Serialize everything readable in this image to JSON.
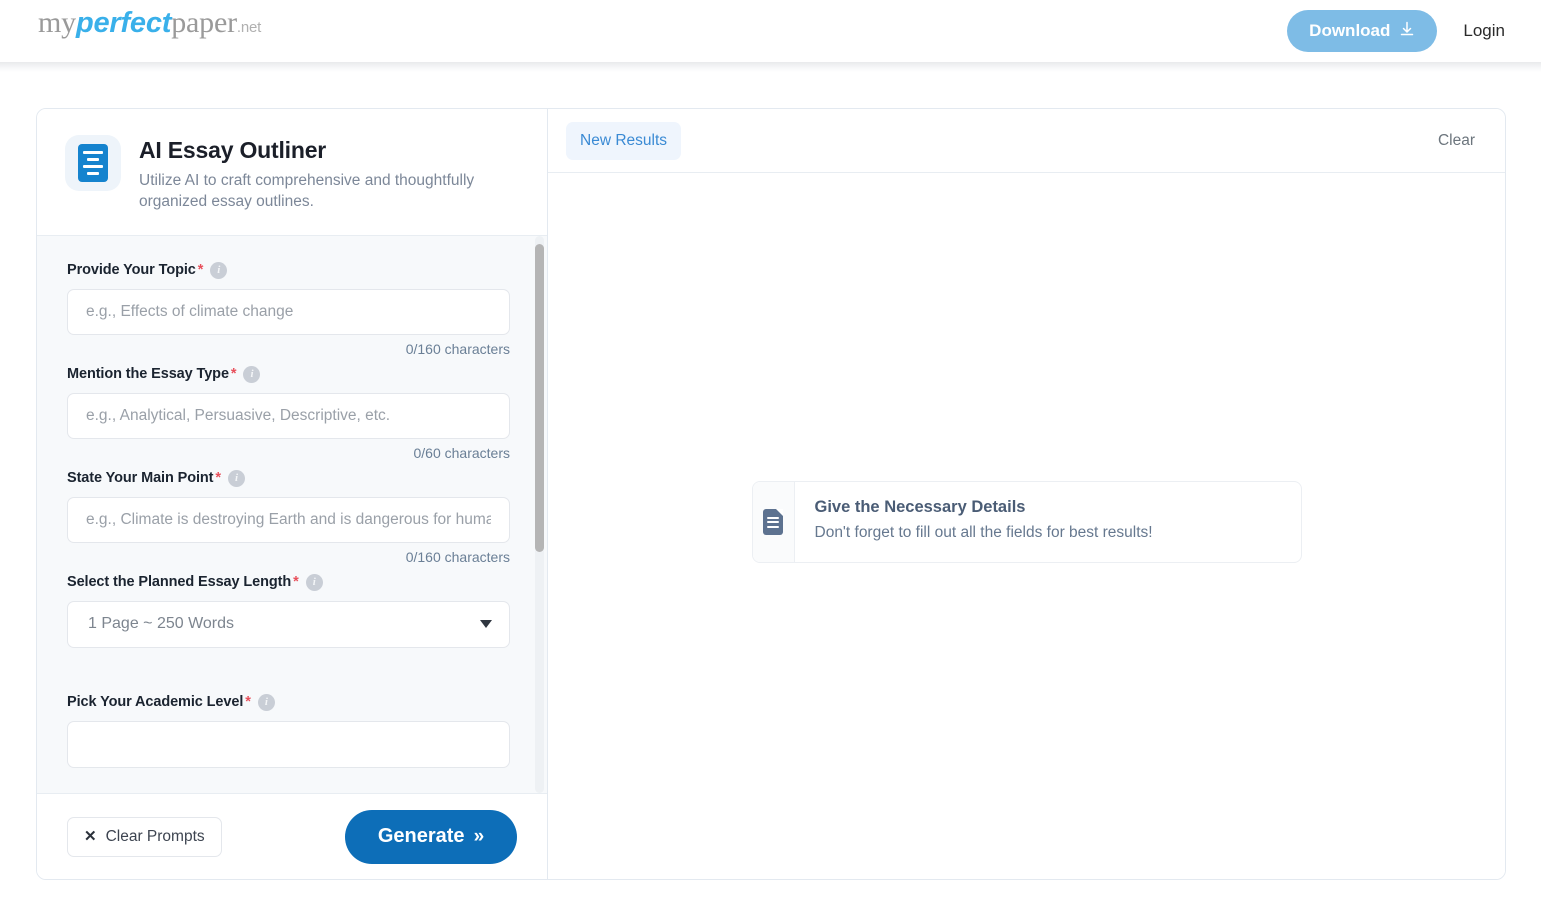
{
  "header": {
    "logo": {
      "part1": "my",
      "part2": "perfect",
      "part3": "paper",
      "part4": ".net"
    },
    "download_label": "Download",
    "download_icon": "download-arrow-icon",
    "login_label": "Login"
  },
  "tool": {
    "icon": "document-lines-icon",
    "title": "AI Essay Outliner",
    "subtitle": "Utilize AI to craft comprehensive and thoughtfully organized essay outlines."
  },
  "form": {
    "fields": [
      {
        "label": "Provide Your Topic",
        "required": "*",
        "info": "i",
        "placeholder": "e.g., Effects of climate change",
        "value": "",
        "counter": "0/160 characters",
        "type": "text"
      },
      {
        "label": "Mention the Essay Type",
        "required": "*",
        "info": "i",
        "placeholder": "e.g., Analytical, Persuasive, Descriptive, etc.",
        "value": "",
        "counter": "0/60 characters",
        "type": "text"
      },
      {
        "label": "State Your Main Point",
        "required": "*",
        "info": "i",
        "placeholder": "e.g., Climate is destroying Earth and is dangerous for humans",
        "value": "",
        "counter": "0/160 characters",
        "type": "text"
      },
      {
        "label": "Select the Planned Essay Length",
        "required": "*",
        "info": "i",
        "selected": "1 Page ~ 250 Words",
        "type": "select"
      },
      {
        "label": "Pick Your Academic Level",
        "required": "*",
        "info": "i",
        "placeholder": "",
        "value": "",
        "type": "select-clipped"
      }
    ]
  },
  "footer": {
    "clear_prompts_label": "Clear Prompts",
    "clear_icon": "x-icon",
    "generate_label": "Generate",
    "generate_icon": "double-chevron-right-icon"
  },
  "results": {
    "tab_label": "New Results",
    "clear_label": "Clear",
    "notice": {
      "icon": "document-icon",
      "title": "Give the Necessary Details",
      "subtitle": "Don't forget to fill out all the fields for best results!"
    }
  },
  "colors": {
    "brand_blue": "#39b0ea",
    "primary_blue": "#0d6eb8",
    "download_blue": "#7ebce6",
    "tab_blue": "#3a8ad4",
    "required_red": "#e8505b",
    "counter_gray": "#6a7f96"
  }
}
